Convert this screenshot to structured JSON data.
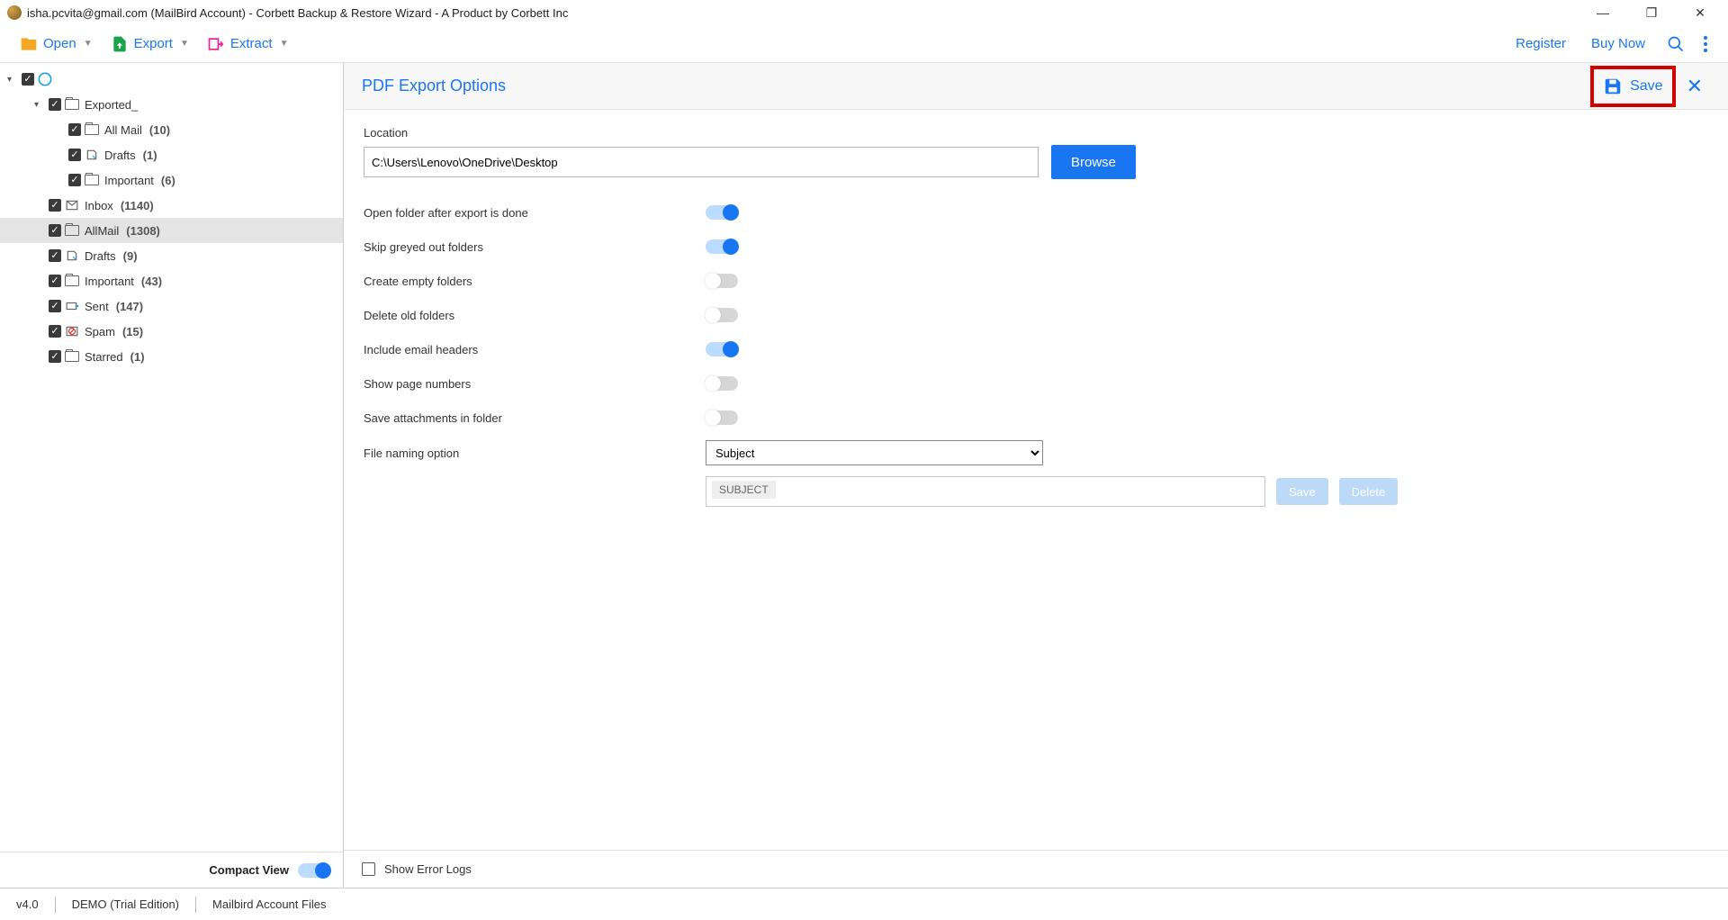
{
  "title": "isha.pcvita@gmail.com (MailBird Account) - Corbett Backup & Restore Wizard - A Product by Corbett Inc",
  "toolbar": {
    "open": "Open",
    "export": "Export",
    "extract": "Extract",
    "register": "Register",
    "buynow": "Buy Now"
  },
  "tree": {
    "root_label": "",
    "exported": {
      "label": "Exported_"
    },
    "allmail_sub": {
      "label": "All Mail",
      "count": "(10)"
    },
    "drafts_sub": {
      "label": "Drafts",
      "count": "(1)"
    },
    "important_sub": {
      "label": "Important",
      "count": "(6)"
    },
    "inbox": {
      "label": "Inbox",
      "count": "(1140)"
    },
    "allmail": {
      "label": "AllMail",
      "count": "(1308)"
    },
    "drafts": {
      "label": "Drafts",
      "count": "(9)"
    },
    "important": {
      "label": "Important",
      "count": "(43)"
    },
    "sent": {
      "label": "Sent",
      "count": "(147)"
    },
    "spam": {
      "label": "Spam",
      "count": "(15)"
    },
    "starred": {
      "label": "Starred",
      "count": "(1)"
    }
  },
  "compact_view": "Compact View",
  "panel": {
    "title": "PDF Export Options",
    "save": "Save",
    "location_label": "Location",
    "location_value": "C:\\Users\\Lenovo\\OneDrive\\Desktop",
    "browse": "Browse",
    "opts": {
      "open_after": "Open folder after export is done",
      "skip_greyed": "Skip greyed out folders",
      "create_empty": "Create empty folders",
      "delete_old": "Delete old folders",
      "include_headers": "Include email headers",
      "show_page": "Show page numbers",
      "save_attach": "Save attachments in folder",
      "file_naming": "File naming option"
    },
    "naming_selected": "Subject",
    "naming_chip": "SUBJECT",
    "naming_save": "Save",
    "naming_delete": "Delete",
    "show_error_logs": "Show Error Logs"
  },
  "status": {
    "version": "v4.0",
    "demo": "DEMO (Trial Edition)",
    "files": "Mailbird Account Files"
  }
}
